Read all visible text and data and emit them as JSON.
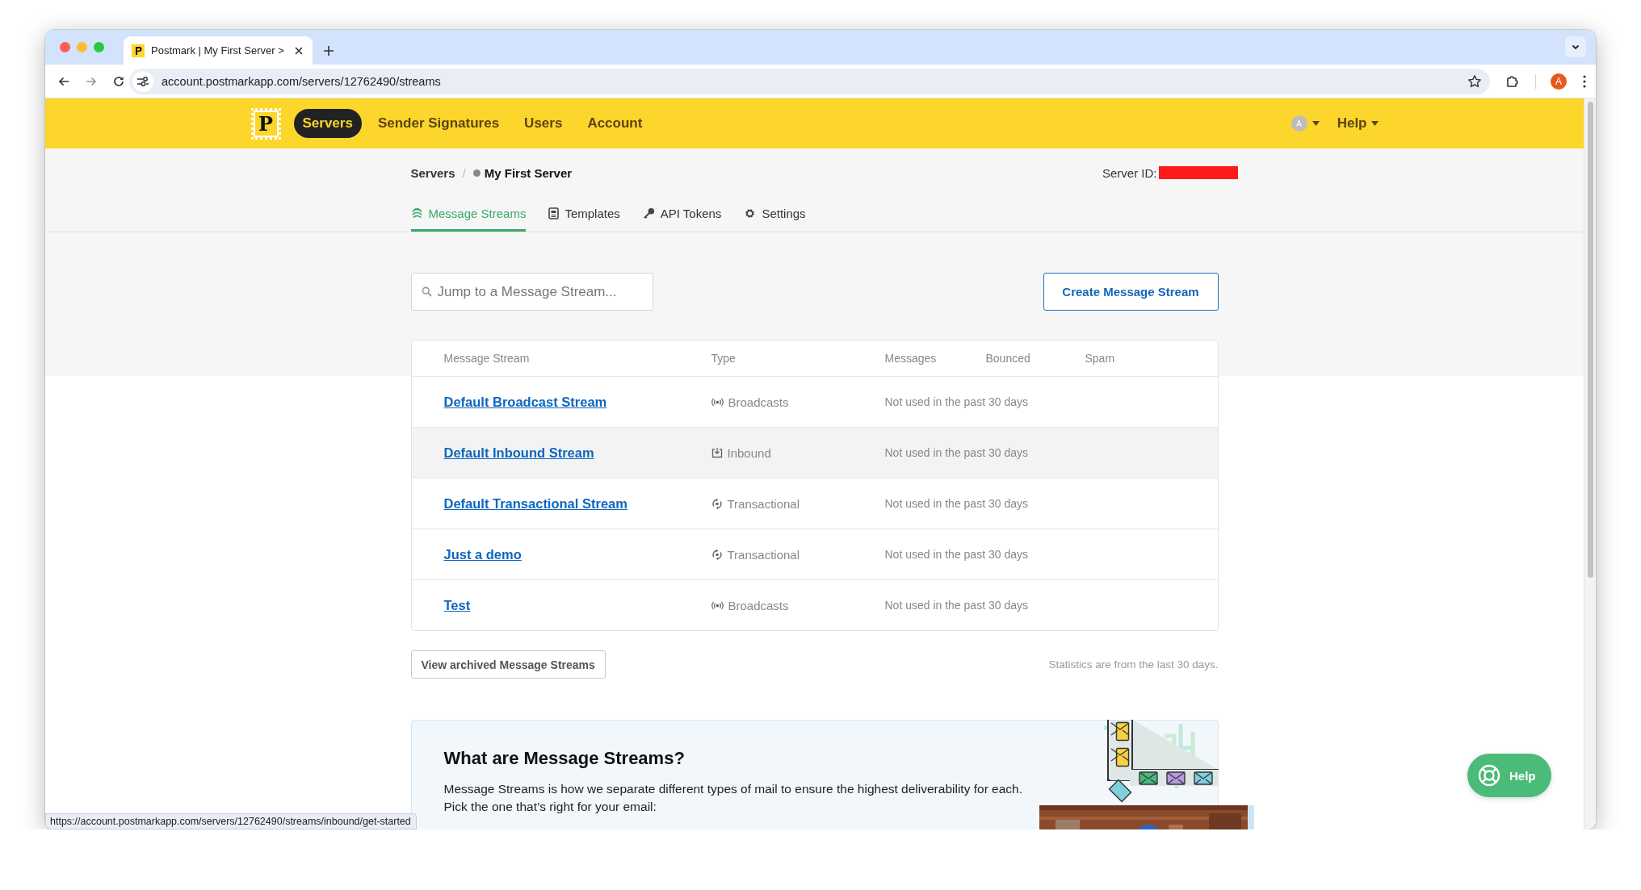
{
  "browser": {
    "tab_title": "Postmark | My First Server >",
    "url": "account.postmarkapp.com/servers/12762490/streams",
    "profile_initial": "A"
  },
  "nav": {
    "logo": "P",
    "items": [
      {
        "label": "Servers",
        "selected": true
      },
      {
        "label": "Sender Signatures",
        "selected": false
      },
      {
        "label": "Users",
        "selected": false
      },
      {
        "label": "Account",
        "selected": false
      }
    ],
    "avatar_initial": "A",
    "help": "Help"
  },
  "breadcrumb": {
    "root": "Servers",
    "separator": "/",
    "current": "My First Server"
  },
  "server_id": {
    "label": "Server ID:"
  },
  "tabs": [
    {
      "label": "Message Streams",
      "selected": true
    },
    {
      "label": "Templates",
      "selected": false
    },
    {
      "label": "API Tokens",
      "selected": false
    },
    {
      "label": "Settings",
      "selected": false
    }
  ],
  "search": {
    "placeholder": "Jump to a Message Stream..."
  },
  "create_button": "Create Message Stream",
  "table": {
    "columns": [
      "Message Stream",
      "Type",
      "Messages",
      "Bounced",
      "Spam"
    ],
    "rows": [
      {
        "name": "Default Broadcast Stream",
        "kind": "broadcast",
        "type": "Broadcasts",
        "messages": "Not used in the past 30 days",
        "highlighted": false
      },
      {
        "name": "Default Inbound Stream",
        "kind": "inbound",
        "type": "Inbound",
        "messages": "Not used in the past 30 days",
        "highlighted": true
      },
      {
        "name": "Default Transactional Stream",
        "kind": "transactional",
        "type": "Transactional",
        "messages": "Not used in the past 30 days",
        "highlighted": false
      },
      {
        "name": "Just a demo",
        "kind": "transactional",
        "type": "Transactional",
        "messages": "Not used in the past 30 days",
        "highlighted": false
      },
      {
        "name": "Test",
        "kind": "broadcast",
        "type": "Broadcasts",
        "messages": "Not used in the past 30 days",
        "highlighted": false
      }
    ]
  },
  "archived_button": "View archived Message Streams",
  "stats_note": "Statistics are from the last 30 days.",
  "info_card": {
    "title": "What are Message Streams?",
    "lines": [
      "Message Streams is how we separate different types of mail to ensure the highest deliverability for each.",
      "Pick the one that’s right for your email:"
    ]
  },
  "status_url": "https://account.postmarkapp.com/servers/12762490/streams/inbound/get-started",
  "help_button": "Help"
}
